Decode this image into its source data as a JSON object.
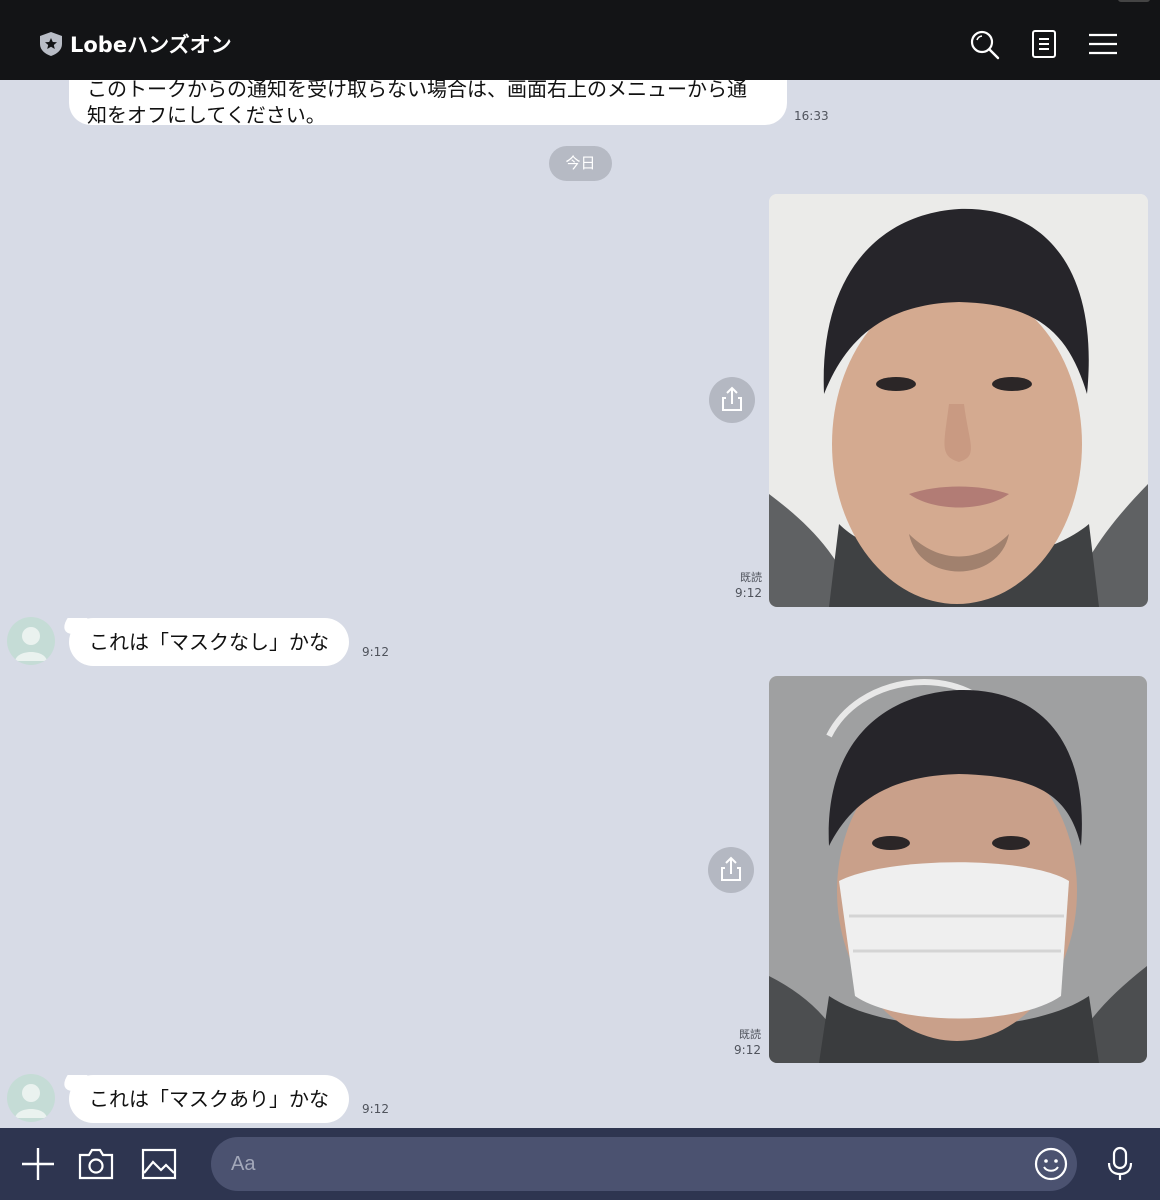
{
  "header": {
    "title": "Lobeハンズオン",
    "icons": [
      "shield-star-icon",
      "search-icon",
      "notes-icon",
      "menu-icon"
    ]
  },
  "messages": {
    "top": {
      "text_line1": "このトークからの通知を受け取らない場合は、画面右上のメニューから通",
      "text_line2": "知をオフにしてください。",
      "time": "16:33"
    },
    "date_separator": "今日",
    "photo1": {
      "read": "既読",
      "time": "9:12"
    },
    "reply1": {
      "text": "これは「マスクなし」かな",
      "time": "9:12"
    },
    "photo2": {
      "read": "既読",
      "time": "9:12"
    },
    "reply2": {
      "text": "これは「マスクあり」かな",
      "time": "9:12"
    }
  },
  "footer": {
    "input_placeholder": "Aa",
    "icons": [
      "plus-icon",
      "camera-icon",
      "image-icon",
      "emoji-icon",
      "microphone-icon"
    ]
  },
  "colors": {
    "header_bg": "#131416",
    "chat_bg": "#d7dbe6",
    "footer_bg": "#2e3550",
    "bubble_bg": "#ffffff"
  }
}
